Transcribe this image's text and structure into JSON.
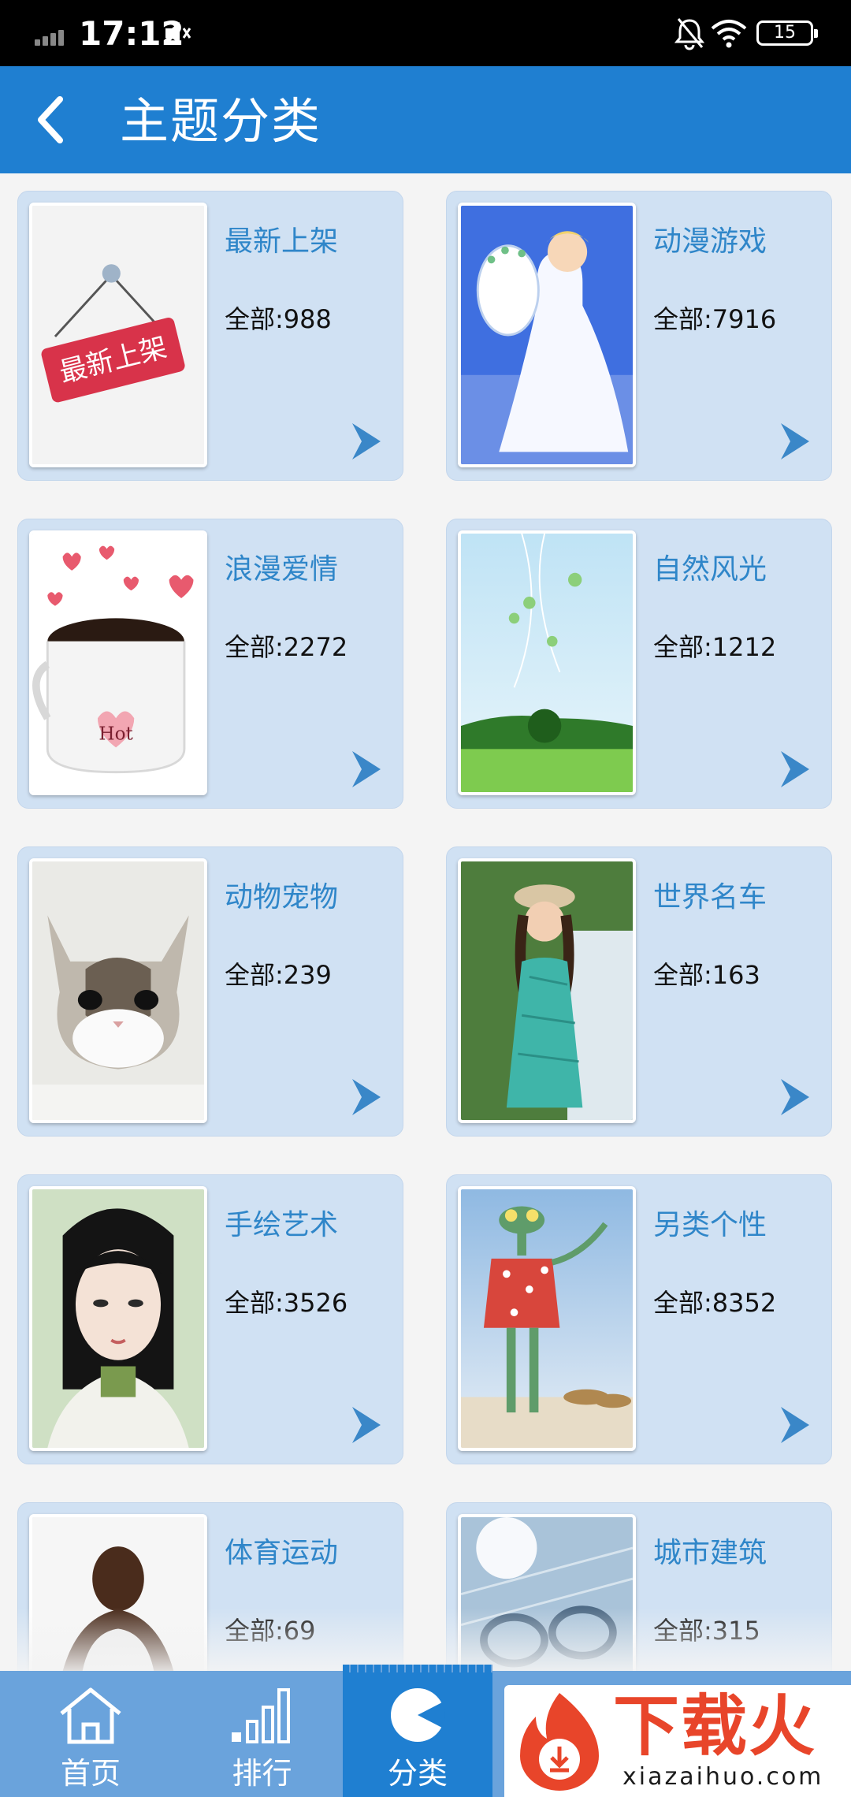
{
  "status_bar": {
    "time": "17:12",
    "battery": "15"
  },
  "header": {
    "title": "主题分类"
  },
  "categories": [
    {
      "name": "最新上架",
      "count": "全部:988",
      "thumb_text": "最新上架"
    },
    {
      "name": "动漫游戏",
      "count": "全部:7916"
    },
    {
      "name": "浪漫爱情",
      "count": "全部:2272",
      "thumb_text": "Hot"
    },
    {
      "name": "自然风光",
      "count": "全部:1212"
    },
    {
      "name": "动物宠物",
      "count": "全部:239"
    },
    {
      "name": "世界名车",
      "count": "全部:163"
    },
    {
      "name": "手绘艺术",
      "count": "全部:3526"
    },
    {
      "name": "另类个性",
      "count": "全部:8352"
    },
    {
      "name": "体育运动",
      "count": "全部:69"
    },
    {
      "name": "城市建筑",
      "count": "全部:315"
    }
  ],
  "bottom_nav": {
    "items": [
      {
        "label": "首页",
        "icon": "home-icon"
      },
      {
        "label": "排行",
        "icon": "ranking-icon"
      },
      {
        "label": "分类",
        "icon": "category-icon",
        "active": true
      }
    ]
  },
  "watermark": {
    "brand": "下载火",
    "site": "xiazaihuo.com"
  },
  "colors": {
    "header": "#1f7fd1",
    "card": "#d0e1f3",
    "nav": "#6aa3dc",
    "category_text": "#2f86c9"
  }
}
